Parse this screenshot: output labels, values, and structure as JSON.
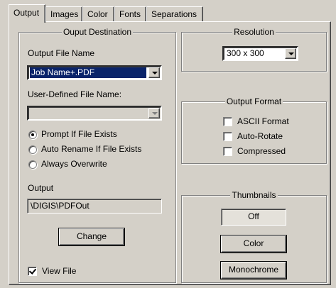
{
  "tabs": [
    {
      "label": "Output",
      "active": true
    },
    {
      "label": "Images",
      "active": false
    },
    {
      "label": "Color",
      "active": false
    },
    {
      "label": "Fonts",
      "active": false
    },
    {
      "label": "Separations",
      "active": false
    }
  ],
  "destination": {
    "title": "Ouput Destination",
    "file_name_label": "Output File Name",
    "file_name_value": "Job Name+.PDF",
    "user_defined_label": "User-Defined File Name:",
    "user_defined_value": "",
    "radios": [
      {
        "label": "Prompt If File Exists",
        "selected": true
      },
      {
        "label": "Auto Rename If File Exists",
        "selected": false
      },
      {
        "label": "Always Overwrite",
        "selected": false
      }
    ],
    "output_label": "Output",
    "output_value": "\\DIGIS\\PDFOut",
    "change_button": "Change",
    "view_file_label": "View File",
    "view_file_checked": true
  },
  "resolution": {
    "title": "Resolution",
    "value": "300 x 300"
  },
  "output_format": {
    "title": "Output Format",
    "options": [
      {
        "label": "ASCII Format",
        "checked": false
      },
      {
        "label": "Auto-Rotate",
        "checked": false
      },
      {
        "label": "Compressed",
        "checked": false
      }
    ]
  },
  "thumbnails": {
    "title": "Thumbnails",
    "buttons": [
      {
        "label": "Off",
        "pressed": true
      },
      {
        "label": "Color",
        "pressed": false
      },
      {
        "label": "Monochrome",
        "pressed": false
      }
    ]
  }
}
